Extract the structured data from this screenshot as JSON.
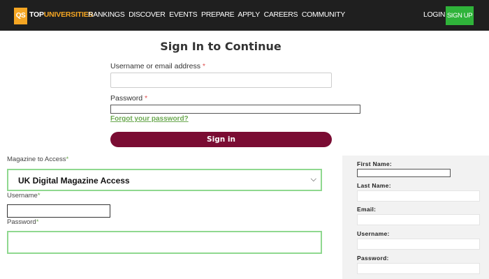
{
  "header": {
    "logo_mark": "QS",
    "logo_top": "TOP",
    "logo_rest": "UNIVERSITIES",
    "nav": [
      "RANKINGS",
      "DISCOVER",
      "EVENTS",
      "PREPARE",
      "APPLY",
      "CAREERS",
      "COMMUNITY"
    ],
    "login_label": "LOGIN",
    "signup_label": "SIGN UP"
  },
  "signin": {
    "title": "Sign In to Continue",
    "username_label": "Username or email address",
    "required_mark": "*",
    "username_value": "",
    "password_label": "Password",
    "password_value": "",
    "forgot_link": "Forgot your password?",
    "submit_label": "Sign in"
  },
  "magazine": {
    "access_label": "Magazine to Access",
    "required_mark": "*",
    "access_selected": "UK Digital Magazine Access",
    "username_label": "Username",
    "username_value": "",
    "password_label": "Password",
    "password_value": ""
  },
  "register": {
    "first_name_label": "First Name:",
    "last_name_label": "Last Name:",
    "email_label": "Email:",
    "username_label": "Username:",
    "password_label": "Password:"
  },
  "colors": {
    "header_bg": "#1f1f1f",
    "brand_orange": "#f5a623",
    "signup_green": "#2fb33a",
    "signin_button": "#7a0c33",
    "forgot_link": "#6aa84f",
    "focus_outline": "#8fd88f"
  },
  "icons": {
    "select_arrow": "chevron-down-icon"
  }
}
